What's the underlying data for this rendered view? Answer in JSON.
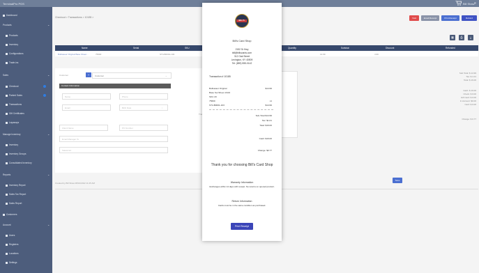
{
  "app": {
    "title": "TerminalPro POS",
    "user": "Bill Shaw",
    "menu_icon": "hamburger-icon",
    "cart_icon": "cart-icon"
  },
  "sidebar": {
    "dashboard": "Dashboard",
    "products": "Products",
    "product_items": [
      "Products",
      "Inventory",
      "Configurations",
      "Trade-ins"
    ],
    "sales": "Sales",
    "sales_items": [
      "Checkout",
      "Parked Sales",
      "Transactions",
      "Gift Certificates",
      "Layaways"
    ],
    "manage_inventory": "Manage Inventory",
    "inventory_items": [
      "Inventory",
      "Inventory Groups",
      "Consolidated Inventory"
    ],
    "reports": "Reports",
    "report_items": [
      "Inventory Report",
      "Sales Tax Report",
      "Sales Report"
    ],
    "customers": "Customers",
    "account": "Account",
    "account_items": [
      "Users",
      "Registers",
      "Locations",
      "Settings"
    ]
  },
  "breadcrumb": "Checkout > Transactions > 10185 >",
  "toolbar": {
    "void": "Void",
    "email_receipt": "Email Receipt",
    "print_receipt": "Print Receipt",
    "refund": "Refund"
  },
  "table": {
    "headers": [
      "Name",
      "Serial",
      "SKU",
      "Quantity",
      "Subtotal",
      "Discount",
      "Refunded"
    ],
    "row": [
      "Bulbasaur Original Base Sheet...",
      "75600",
      "ST4-B0001-103",
      "1",
      "14.99",
      "4.99",
      ""
    ]
  },
  "customer": {
    "label": "Customer",
    "select_value": "Customer",
    "contact_header": "Contact Information",
    "name_ph": "Name",
    "phone_ph": "Phone",
    "email_ph": "Email",
    "birth_ph": "Birth Date",
    "client_ph": "Client Name",
    "po_ph": "PO Number",
    "manager_ph": "Email Manager To",
    "salesman_ph": "Salesman"
  },
  "notes_label": "Notes",
  "transaction_label": "Transaction Bar",
  "totals": {
    "subtotal": "Sub Total: $ 14.99",
    "tax": "Tax: $ 1.01",
    "total": "Total: $ 16.00",
    "cash": "Cash: $ 16.00",
    "check": "Check: $ 0.00",
    "gift_card": "Gift Card: $ 0.00",
    "in_account": "In Account: $0.00",
    "card": "Card: $ 0.00",
    "change": "Change: $ 0.77"
  },
  "save_button": "Save",
  "updated_text": "Created by Bill Shaw 08/16/2022 11:25 AM",
  "receipt": {
    "store_name": "Bill's Card Shop",
    "logo_text": "BILL'S",
    "address": [
      "2152 Sr Hwy",
      "bill@billscards.com",
      "312 Oak Street",
      "Lexington, KY 40509",
      "Tel: (859) 555-0142"
    ],
    "transaction": "Transaction # 10185",
    "items": [
      {
        "name": "Bulbasaur Original",
        "value": "$14.99"
      },
      {
        "name": "Base Set Sheet 1/102",
        "value": ""
      },
      {
        "name": "SKU 20",
        "value": ""
      },
      {
        "name": "75600",
        "value": "x1"
      },
      {
        "name": "ST4-B0001-103",
        "value": "$14.99"
      }
    ],
    "subtotal": "Sub-Total $14.99",
    "tax": "Tax: $1.01",
    "total": "Total: $16.00",
    "cash": "Cash: $16.00",
    "change": "Change: $0.77",
    "thanks": "Thank you for choosing Bill's Card Shop",
    "warranty_title": "Warranty Information",
    "warranty_text": "Exchanges within 14 days with receipt. No returns on opened product.",
    "return_title": "Return Information",
    "return_text": "Cards must be in the same condition as purchased.",
    "print_button": "Print Receipt"
  }
}
